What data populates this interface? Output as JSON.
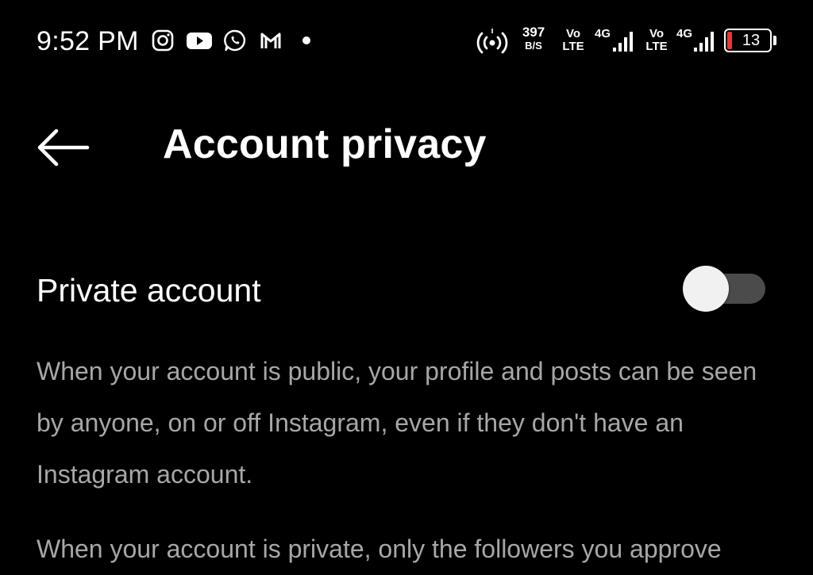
{
  "status_bar": {
    "time": "9:52 PM",
    "notification_icons": [
      "instagram-icon",
      "youtube-icon",
      "whatsapp-icon",
      "gmail-icon",
      "more-notifications-dot"
    ],
    "hotspot_icon": "hotspot-icon",
    "network_speed": {
      "value": "397",
      "unit": "B/S"
    },
    "sim1": {
      "volte_top": "Vo",
      "volte_bottom": "LTE",
      "type": "4G"
    },
    "sim2": {
      "volte_top": "Vo",
      "volte_bottom": "LTE",
      "type": "4G"
    },
    "battery": {
      "percent": "13",
      "level": 0.13,
      "color": "#e53935"
    }
  },
  "header": {
    "back_icon": "back-arrow-icon",
    "title": "Account privacy"
  },
  "setting": {
    "label": "Private account",
    "enabled": false
  },
  "description": {
    "paragraph_1": "When your account is public, your profile and posts can be seen by anyone, on or off Instagram, even if they don't have an Instagram account.",
    "paragraph_2": "When your account is private, only the followers you approve"
  },
  "colors": {
    "background": "#000000",
    "text_primary": "#ffffff",
    "text_secondary": "#a7a7a7",
    "toggle_track": "#4b4b4b",
    "toggle_thumb": "#f1f1f1"
  }
}
